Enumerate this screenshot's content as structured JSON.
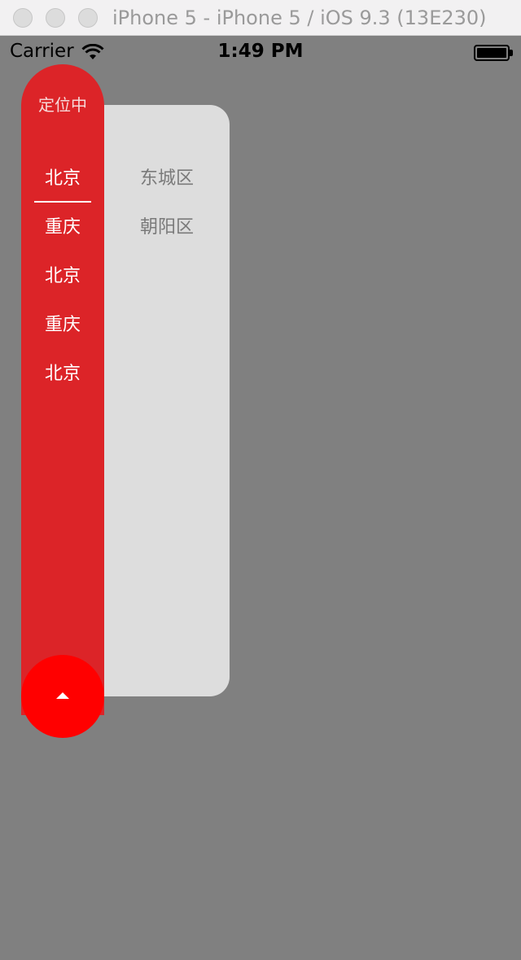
{
  "window": {
    "title": "iPhone 5 - iPhone 5 / iOS 9.3 (13E230)"
  },
  "status_bar": {
    "carrier": "Carrier",
    "time": "1:49 PM",
    "wifi_icon": "wifi-icon",
    "battery_icon": "battery-icon"
  },
  "city_picker": {
    "locating_label": "定位中",
    "cities": [
      "北京",
      "重庆",
      "北京",
      "重庆",
      "北京"
    ],
    "selected_index": 0,
    "districts": [
      "东城区",
      "朝阳区"
    ],
    "collapse_icon": "triangle-up-icon"
  },
  "colors": {
    "background": "#808080",
    "city_column": "#dc2428",
    "collapse_button": "#ff0000",
    "district_panel": "#dddddd",
    "district_text": "#7a7a7a"
  }
}
